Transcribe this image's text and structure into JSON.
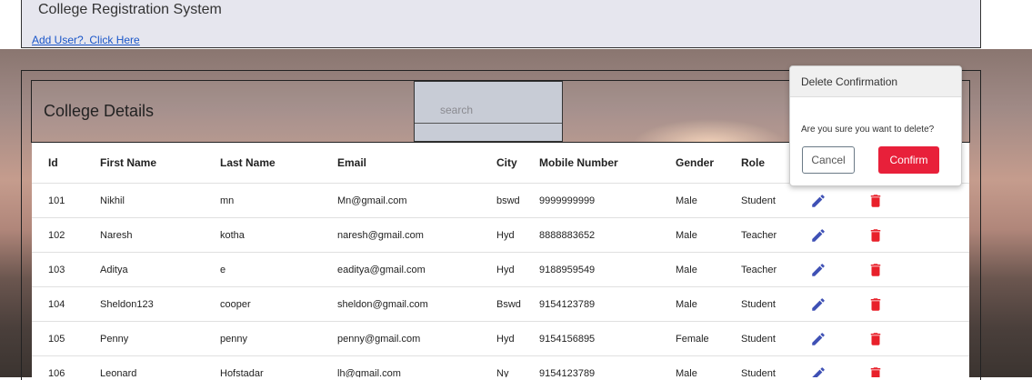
{
  "header": {
    "title": "College Registration System",
    "add_user_link": "Add User?. Click Here"
  },
  "card": {
    "title": "College Details",
    "search_placeholder": "search"
  },
  "table": {
    "columns": [
      "Id",
      "First Name",
      "Last Name",
      "Email",
      "City",
      "Mobile Number",
      "Gender",
      "Role",
      "",
      ""
    ],
    "rows": [
      {
        "id": "101",
        "first": "Nikhil",
        "last": "mn",
        "email": "Mn@gmail.com",
        "city": "bswd",
        "mobile": "9999999999",
        "gender": "Male",
        "role": "Student"
      },
      {
        "id": "102",
        "first": "Naresh",
        "last": "kotha",
        "email": "naresh@gmail.com",
        "city": "Hyd",
        "mobile": "8888883652",
        "gender": "Male",
        "role": "Teacher"
      },
      {
        "id": "103",
        "first": "Aditya",
        "last": "e",
        "email": "eaditya@gmail.com",
        "city": "Hyd",
        "mobile": "9188959549",
        "gender": "Male",
        "role": "Teacher"
      },
      {
        "id": "104",
        "first": "Sheldon123",
        "last": "cooper",
        "email": "sheldon@gmail.com",
        "city": "Bswd",
        "mobile": "9154123789",
        "gender": "Male",
        "role": "Student"
      },
      {
        "id": "105",
        "first": "Penny",
        "last": "penny",
        "email": "penny@gmail.com",
        "city": "Hyd",
        "mobile": "9154156895",
        "gender": "Female",
        "role": "Student"
      },
      {
        "id": "106",
        "first": "Leonard",
        "last": "Hofstadar",
        "email": "lh@gmail.com",
        "city": "Ny",
        "mobile": "9154123789",
        "gender": "Male",
        "role": "Student"
      }
    ],
    "icons": {
      "edit": "pencil-icon",
      "delete": "trash-icon"
    }
  },
  "popover": {
    "title": "Delete Confirmation",
    "message": "Are you sure you want to delete?",
    "cancel_label": "Cancel",
    "confirm_label": "Confirm"
  },
  "colors": {
    "edit_icon": "#3f51b5",
    "delete_icon": "#e8202a",
    "confirm_button": "#e8203a",
    "link": "#1a56c9"
  }
}
